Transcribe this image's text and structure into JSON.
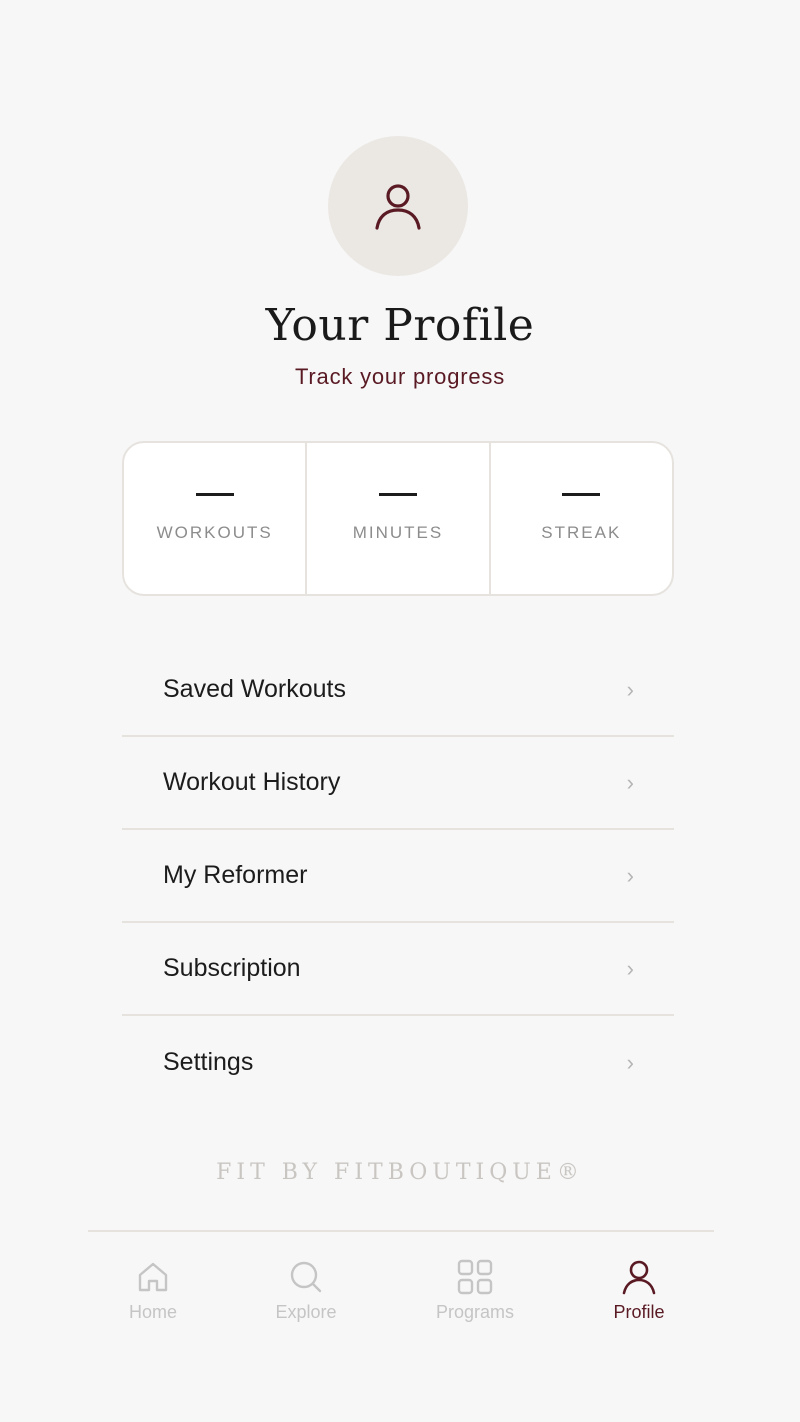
{
  "header": {
    "avatar_icon": "user-icon",
    "title": "Your Profile",
    "subtitle": "Track your progress"
  },
  "stats": [
    {
      "value": "—",
      "label": "WORKOUTS"
    },
    {
      "value": "—",
      "label": "MINUTES"
    },
    {
      "value": "—",
      "label": "STREAK"
    }
  ],
  "menu": [
    {
      "label": "Saved Workouts",
      "icon": "chevron-right-icon"
    },
    {
      "label": "Workout History",
      "icon": "chevron-right-icon"
    },
    {
      "label": "My Reformer",
      "icon": "chevron-right-icon"
    },
    {
      "label": "Subscription",
      "icon": "chevron-right-icon"
    },
    {
      "label": "Settings",
      "icon": "chevron-right-icon"
    }
  ],
  "chevron_glyph": "›",
  "brand": "FIT BY FITBOUTIQUE®",
  "tabbar": {
    "tabs": [
      {
        "label": "Home",
        "icon": "home-icon",
        "active": false
      },
      {
        "label": "Explore",
        "icon": "search-icon",
        "active": false
      },
      {
        "label": "Programs",
        "icon": "grid-icon",
        "active": false
      },
      {
        "label": "Profile",
        "icon": "user-icon",
        "active": true
      }
    ]
  },
  "colors": {
    "accent": "#5a1a24",
    "background": "#f7f7f7",
    "avatar_bg": "#ebe8e4",
    "inactive": "#c5c5c5"
  }
}
